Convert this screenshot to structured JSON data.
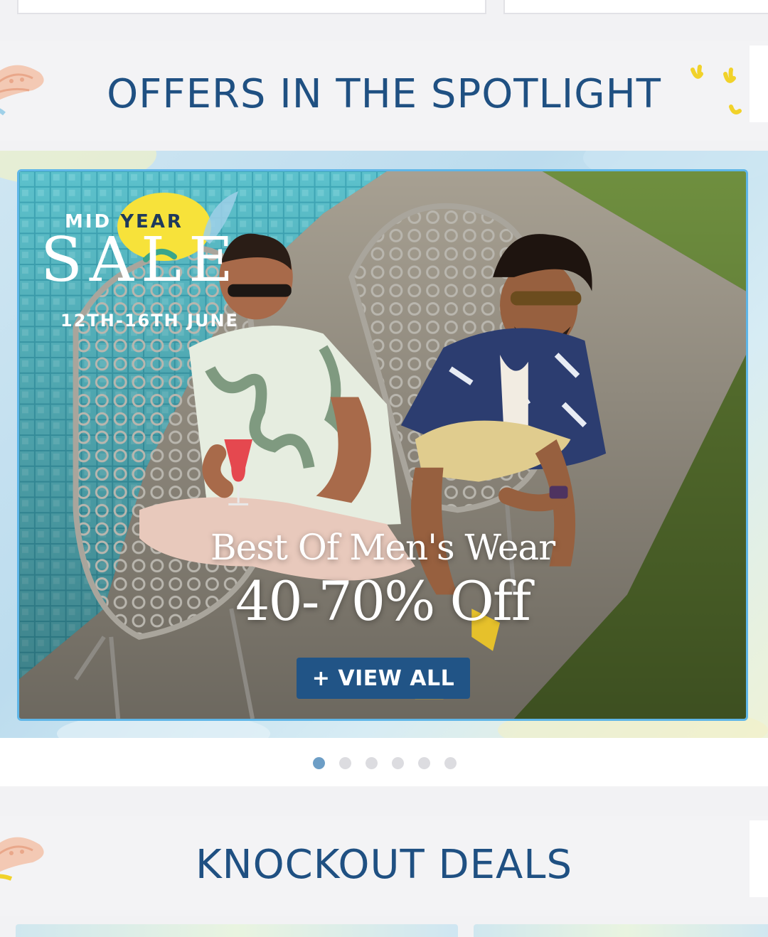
{
  "spotlight": {
    "title": "OFFERS IN THE SPOTLIGHT"
  },
  "banner": {
    "sale_mid": "MID",
    "sale_year": "YEAR",
    "sale_word": "SALE",
    "sale_dates": "12TH-16TH JUNE",
    "headline": "Best Of Men's Wear",
    "discount": "40-70% Off",
    "cta_label": "+ VIEW ALL"
  },
  "carousel": {
    "total_slides": 6,
    "active_index": 0
  },
  "knockout": {
    "title": "KNOCKOUT DEALS"
  },
  "colors": {
    "title_blue": "#1f5082",
    "cta_bg": "#215486",
    "dot_active": "#6d9ec6",
    "banner_border": "#5fb6e8"
  }
}
